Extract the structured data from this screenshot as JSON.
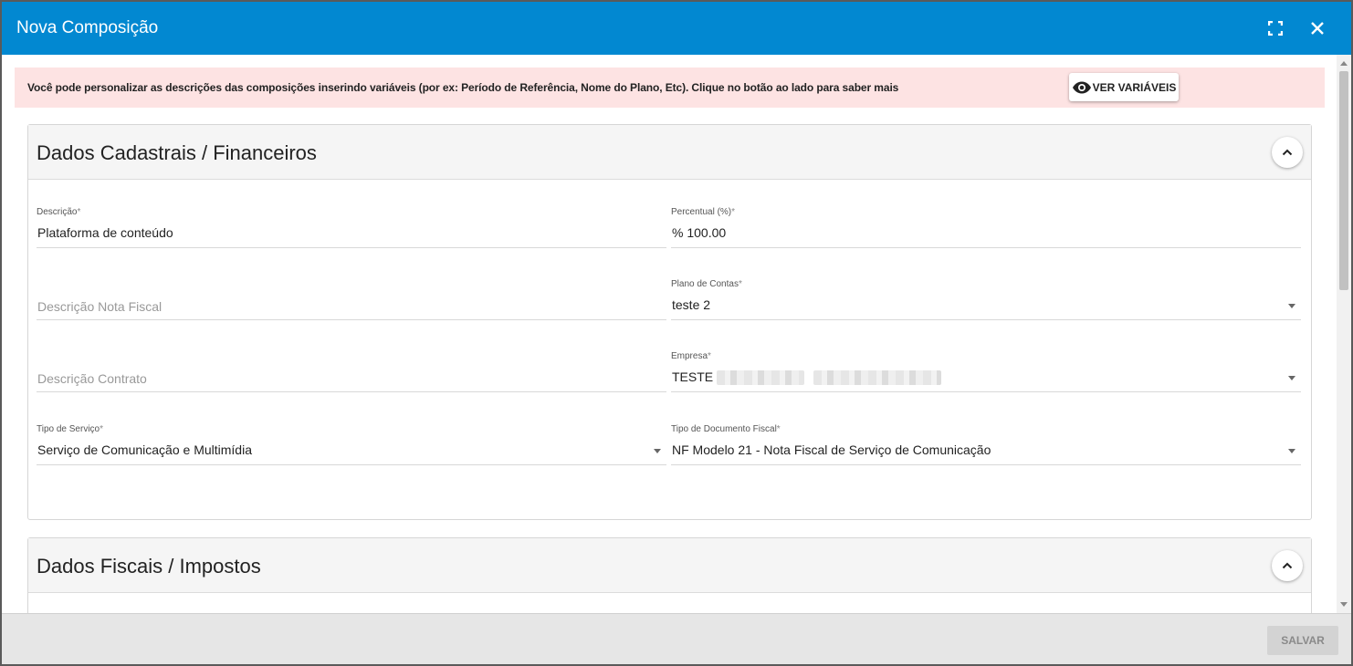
{
  "dialog": {
    "title": "Nova Composição",
    "icons": {
      "maximize": "fullscreen-icon",
      "close": "close-icon"
    }
  },
  "notice": {
    "text": "Você pode personalizar as descrições das composições inserindo variáveis (por ex: Período de Referência, Nome do Plano, Etc). Clique no botão ao lado para saber mais",
    "button_label": "VER VARIÁVEIS",
    "button_icon": "eye-icon",
    "background": "#fde3e3"
  },
  "section1": {
    "title": "Dados Cadastrais / Financeiros",
    "collapse_icon": "chevron-up-icon",
    "fields": {
      "descricao": {
        "label": "Descrição",
        "required": "*",
        "value": "Plataforma de conteúdo"
      },
      "percentual": {
        "label": "Percentual (%)",
        "required": "*",
        "value": "% 100.00"
      },
      "descricao_nf": {
        "placeholder": "Descrição Nota Fiscal"
      },
      "plano_contas": {
        "label": "Plano de Contas",
        "required": "*",
        "value": "teste 2"
      },
      "descricao_contrato": {
        "placeholder": "Descrição Contrato"
      },
      "empresa": {
        "label": "Empresa",
        "required": "*",
        "value": "TESTE"
      },
      "tipo_servico": {
        "label": "Tipo de Serviço",
        "required": "*",
        "value": "Serviço de Comunicação e Multimídia"
      },
      "tipo_documento": {
        "label": "Tipo de Documento Fiscal",
        "required": "*",
        "value": "NF Modelo 21 - Nota Fiscal de Serviço de Comunicação"
      }
    }
  },
  "section2": {
    "title": "Dados Fiscais / Impostos",
    "collapse_icon": "chevron-up-icon"
  },
  "footer": {
    "save_label": "SALVAR"
  },
  "colors": {
    "header_blue": "#0288d1",
    "footer_gray": "#e6e6e6",
    "save_disabled": "#d3d3d3"
  }
}
